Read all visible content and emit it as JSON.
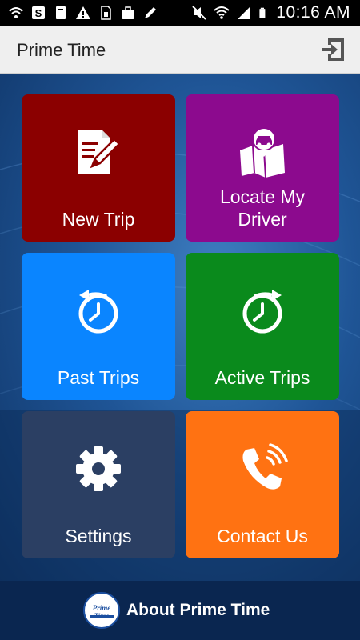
{
  "status_bar": {
    "time": "10:16 AM",
    "icons": [
      "wifi-icon",
      "dollar-app-icon",
      "clipboard-icon",
      "warning-icon",
      "sim-icon",
      "briefcase-icon",
      "pen-icon",
      "mute-icon",
      "wifi-signal-icon",
      "cell-signal-icon",
      "battery-icon"
    ]
  },
  "app_bar": {
    "title": "Prime Time",
    "action_icon": "logout-icon"
  },
  "tiles": [
    {
      "label": "New Trip",
      "icon": "document-edit-icon",
      "color": "#8b0000"
    },
    {
      "label_line1": "Locate My",
      "label_line2": "Driver",
      "icon": "map-car-icon",
      "color": "#8c0a8e"
    },
    {
      "label": "Past Trips",
      "icon": "clock-back-icon",
      "color": "#0a85ff"
    },
    {
      "label": "Active Trips",
      "icon": "clock-forward-icon",
      "color": "#0a8a1c"
    },
    {
      "label": "Settings",
      "icon": "gear-icon",
      "color": "#2b3f63"
    },
    {
      "label": "Contact Us",
      "icon": "phone-icon",
      "color": "#ff7212"
    }
  ],
  "footer": {
    "label": "About Prime Time",
    "logo_text": "Prime Time"
  }
}
